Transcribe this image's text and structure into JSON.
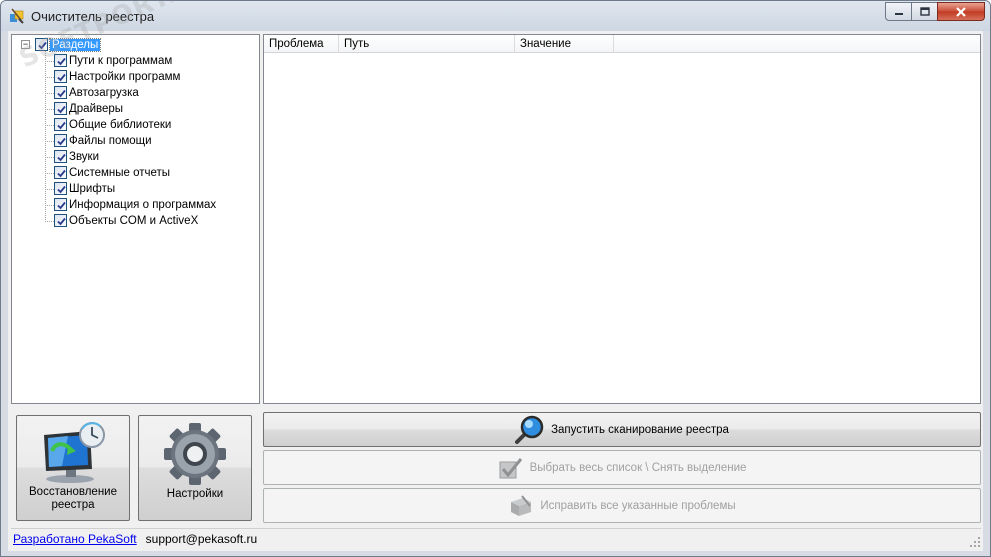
{
  "window": {
    "title": "Очиститель реестра"
  },
  "tree": {
    "expander_symbol": "−",
    "root_label": "Разделы",
    "items": [
      {
        "label": "Пути к программам",
        "checked": true
      },
      {
        "label": "Настройки программ",
        "checked": true
      },
      {
        "label": "Автозагрузка",
        "checked": true
      },
      {
        "label": "Драйверы",
        "checked": true
      },
      {
        "label": "Общие библиотеки",
        "checked": true
      },
      {
        "label": "Файлы помощи",
        "checked": true
      },
      {
        "label": "Звуки",
        "checked": true
      },
      {
        "label": "Системные отчеты",
        "checked": true
      },
      {
        "label": "Шрифты",
        "checked": true
      },
      {
        "label": "Информация о программах",
        "checked": true
      },
      {
        "label": "Объекты COM и ActiveX",
        "checked": true
      }
    ]
  },
  "list": {
    "columns": [
      "Проблема",
      "Путь",
      "Значение"
    ],
    "rows": []
  },
  "buttons": {
    "restore_line1": "Восстановление",
    "restore_line2": "реестра",
    "settings": "Настройки",
    "scan": "Запустить сканирование реестра",
    "select_all": "Выбрать весь список \\ Снять выделение",
    "fix": "Исправить все указанные проблемы"
  },
  "status": {
    "developer_link": "Разработано PekaSoft",
    "email": "support@pekasoft.ru"
  },
  "watermark": "SOFTPORTAL"
}
